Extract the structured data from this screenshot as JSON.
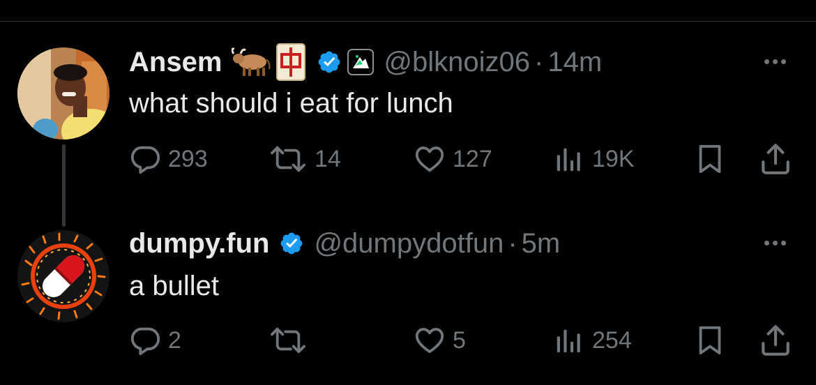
{
  "colors": {
    "background": "#000000",
    "primary_text": "#e7e9ea",
    "secondary_text": "#71767b",
    "verified_blue": "#1d9bf0",
    "divider": "#2f3336"
  },
  "tweets": [
    {
      "display_name": "Ansem",
      "emojis": [
        "cow-emoji",
        "mahjong-red-dragon-emoji",
        "badge-icon"
      ],
      "handle": "@blknoiz06",
      "separator": "·",
      "time": "14m",
      "text": "what should i eat for lunch",
      "replies": "293",
      "reposts": "14",
      "likes": "127",
      "views": "19K"
    },
    {
      "display_name": "dumpy.fun",
      "emojis": [],
      "handle": "@dumpydotfun",
      "separator": "·",
      "time": "5m",
      "text": "a bullet",
      "replies": "2",
      "reposts": "",
      "likes": "5",
      "views": "254"
    }
  ],
  "icons": {
    "reply": "reply-icon",
    "repost": "repost-icon",
    "like": "heart-icon",
    "views": "views-icon",
    "bookmark": "bookmark-icon",
    "share": "share-icon",
    "more": "more-icon",
    "verified": "verified-badge-icon"
  }
}
